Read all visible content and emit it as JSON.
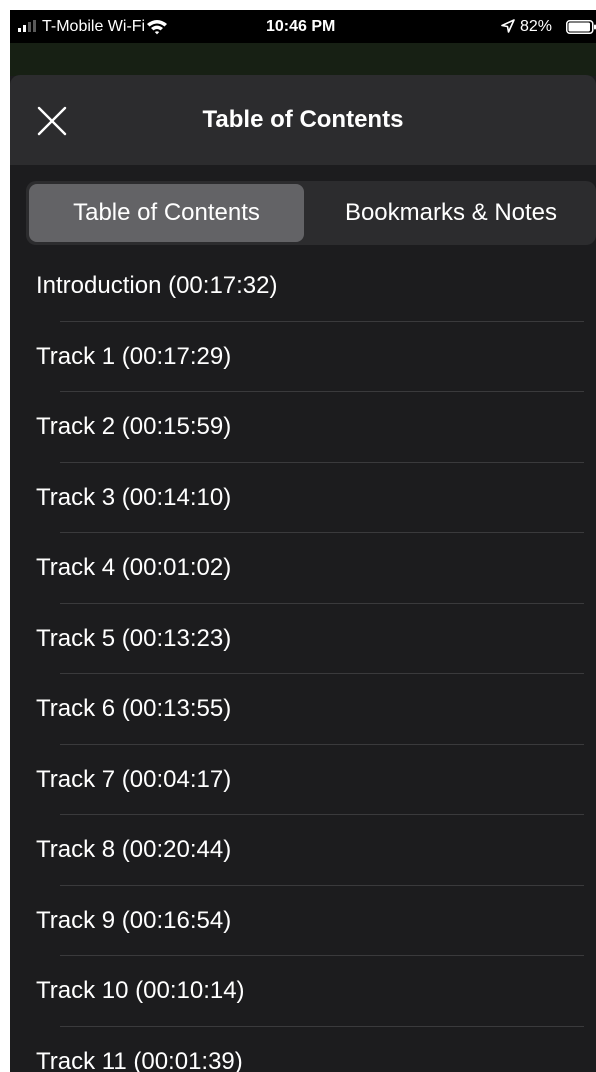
{
  "status_bar": {
    "carrier": "T-Mobile Wi-Fi",
    "time": "10:46 PM",
    "battery_percent": "82%",
    "icons": [
      "signal-icon",
      "wifi-icon",
      "location-icon",
      "battery-icon"
    ]
  },
  "nav": {
    "title": "Table of Contents",
    "close_icon": "close-icon"
  },
  "segments": {
    "selected": "Table of Contents",
    "items": [
      "Table of Contents",
      "Bookmarks & Notes"
    ]
  },
  "toc": {
    "items": [
      "Introduction (00:17:32)",
      "Track 1 (00:17:29)",
      "Track 2 (00:15:59)",
      "Track 3 (00:14:10)",
      "Track 4 (00:01:02)",
      "Track 5 (00:13:23)",
      "Track 6 (00:13:55)",
      "Track 7 (00:04:17)",
      "Track 8 (00:20:44)",
      "Track 9 (00:16:54)",
      "Track 10 (00:10:14)",
      "Track 11 (00:01:39)"
    ]
  },
  "colors": {
    "background": "#1c1c1e",
    "nav_background": "#2c2c2e",
    "segment_selected": "#636366",
    "separator": "#3a3a3c",
    "text": "#ffffff"
  }
}
